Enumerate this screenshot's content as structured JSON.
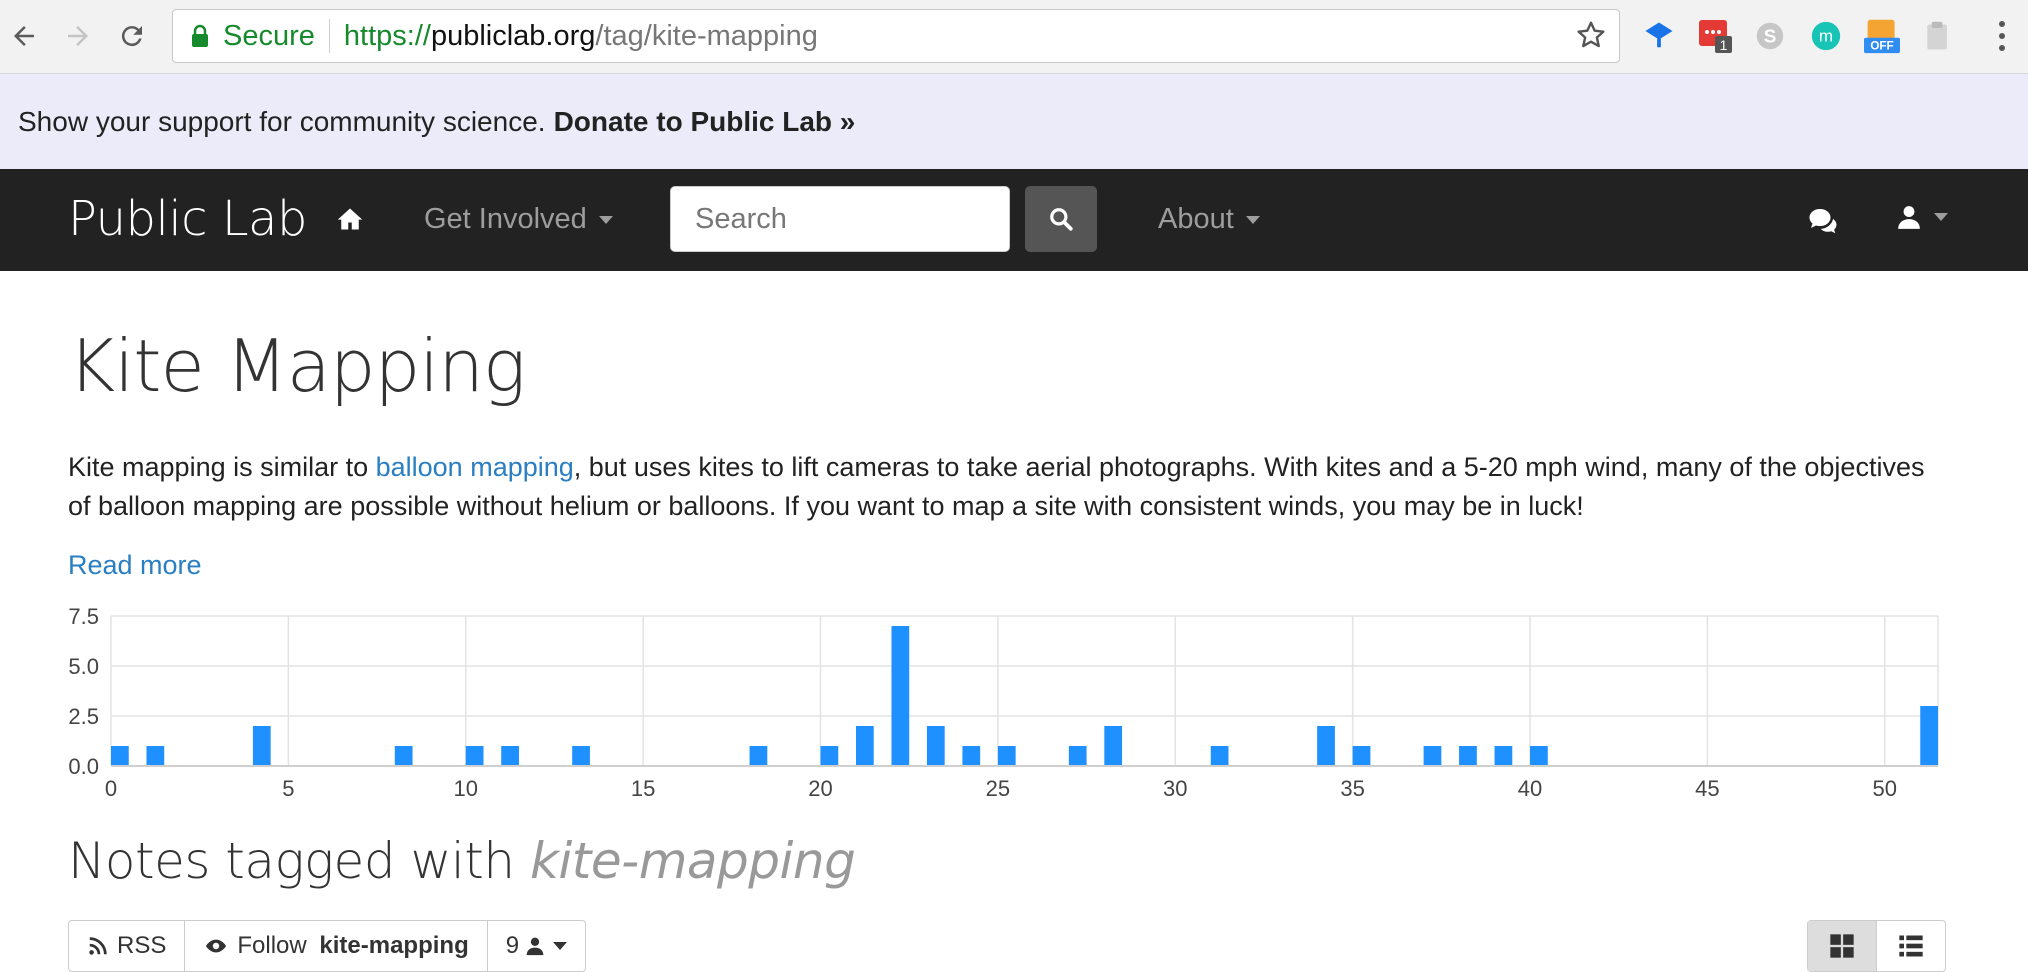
{
  "browser": {
    "secure_label": "Secure",
    "url_scheme": "https://",
    "url_host": "publiclab.org",
    "url_path": "/tag/kite-mapping",
    "extensions": [
      {
        "name": "tree-extension-icon",
        "color": "#1a73e8"
      },
      {
        "name": "todo-extension-icon",
        "color": "#e53935",
        "badge": "1"
      },
      {
        "name": "skype-extension-icon",
        "color": "#bdbdbd"
      },
      {
        "name": "m-extension-icon",
        "color": "#18c4b5",
        "letter": "m"
      },
      {
        "name": "off-extension-icon",
        "color": "#f4a433",
        "badge": "OFF"
      },
      {
        "name": "clipboard-extension-icon",
        "color": "#cccccc"
      }
    ]
  },
  "banner": {
    "text": "Show your support for community science.",
    "link": "Donate to Public Lab »"
  },
  "navbar": {
    "brand": "Public Lab",
    "get_involved": "Get Involved",
    "search_placeholder": "Search",
    "about": "About"
  },
  "page": {
    "title": "Kite Mapping",
    "desc_before": "Kite mapping is similar to ",
    "desc_link": "balloon mapping",
    "desc_after": ", but uses kites to lift cameras to take aerial photographs. With kites and a 5-20 mph wind, many of the objectives of balloon mapping are possible without helium or balloons. If you want to map a site with consistent winds, you may be in luck!",
    "read_more": "Read more",
    "notes_prefix": "Notes tagged with ",
    "notes_tag": "kite-mapping"
  },
  "toolbar": {
    "rss": "RSS",
    "follow_prefix": "Follow ",
    "follow_tag": "kite-mapping",
    "followers": "9"
  },
  "colors": {
    "bar": "#1e90ff",
    "link": "#2a7ec2",
    "navbar_bg": "#222222",
    "banner_bg": "#ebebf9"
  },
  "chart_data": {
    "type": "bar",
    "x": [
      0,
      1,
      4,
      8,
      10,
      11,
      13,
      18,
      20,
      21,
      22,
      23,
      24,
      25,
      27,
      28,
      31,
      34,
      35,
      37,
      38,
      39,
      40,
      51
    ],
    "values": [
      1,
      1,
      2,
      1,
      1,
      1,
      1,
      1,
      1,
      2,
      7,
      2,
      1,
      1,
      1,
      2,
      1,
      2,
      1,
      1,
      1,
      1,
      1,
      3
    ],
    "xlim": [
      0,
      51.5
    ],
    "ylim": [
      0,
      7.5
    ],
    "xticks": [
      "0",
      "5",
      "10",
      "15",
      "20",
      "25",
      "30",
      "35",
      "40",
      "45",
      "50"
    ],
    "yticks": [
      "0.0",
      "2.5",
      "5.0",
      "7.5"
    ],
    "grid": true
  }
}
